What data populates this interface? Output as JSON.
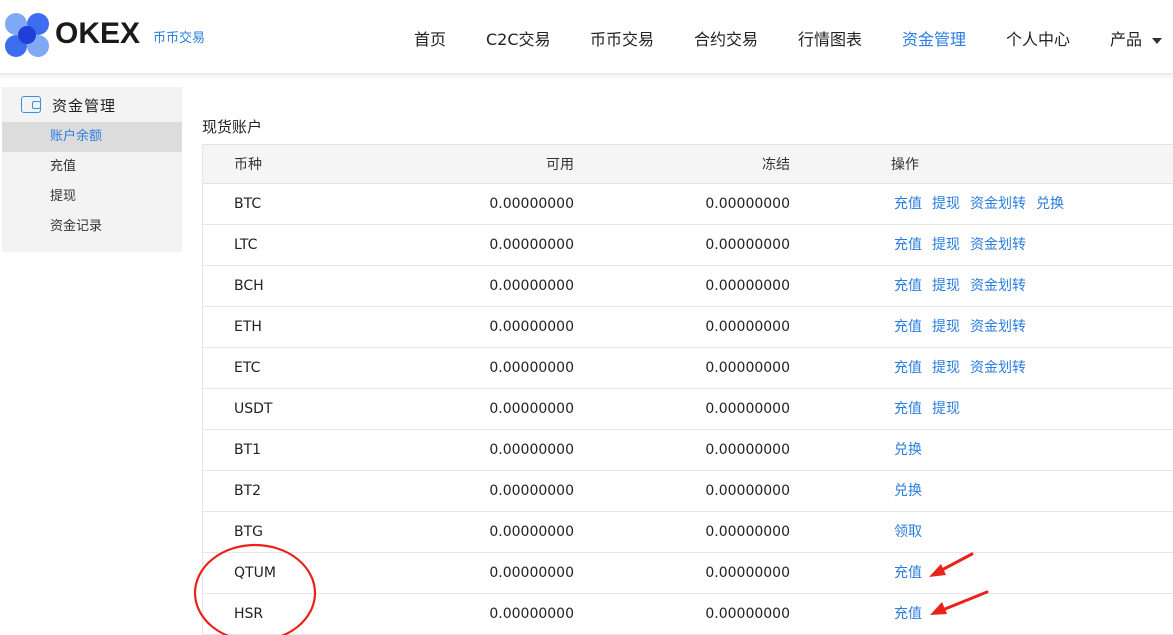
{
  "header": {
    "brand": "OKEX",
    "brand_sub": "币币交易",
    "nav": [
      {
        "label": "首页"
      },
      {
        "label": "C2C交易"
      },
      {
        "label": "币币交易"
      },
      {
        "label": "合约交易"
      },
      {
        "label": "行情图表"
      },
      {
        "label": "资金管理",
        "active": true
      },
      {
        "label": "个人中心"
      },
      {
        "label": "产品",
        "dropdown": true
      }
    ]
  },
  "sidebar": {
    "title": "资金管理",
    "icon": "wallet-icon",
    "items": [
      {
        "label": "账户余额",
        "active": true
      },
      {
        "label": "充值"
      },
      {
        "label": "提现"
      },
      {
        "label": "资金记录"
      }
    ]
  },
  "main": {
    "title": "现货账户",
    "columns": [
      "币种",
      "可用",
      "冻结",
      "操作"
    ],
    "rows": [
      {
        "coin": "BTC",
        "available": "0.00000000",
        "frozen": "0.00000000",
        "ops": [
          "充值",
          "提现",
          "资金划转",
          "兑换"
        ]
      },
      {
        "coin": "LTC",
        "available": "0.00000000",
        "frozen": "0.00000000",
        "ops": [
          "充值",
          "提现",
          "资金划转"
        ]
      },
      {
        "coin": "BCH",
        "available": "0.00000000",
        "frozen": "0.00000000",
        "ops": [
          "充值",
          "提现",
          "资金划转"
        ]
      },
      {
        "coin": "ETH",
        "available": "0.00000000",
        "frozen": "0.00000000",
        "ops": [
          "充值",
          "提现",
          "资金划转"
        ]
      },
      {
        "coin": "ETC",
        "available": "0.00000000",
        "frozen": "0.00000000",
        "ops": [
          "充值",
          "提现",
          "资金划转"
        ]
      },
      {
        "coin": "USDT",
        "available": "0.00000000",
        "frozen": "0.00000000",
        "ops": [
          "充值",
          "提现"
        ]
      },
      {
        "coin": "BT1",
        "available": "0.00000000",
        "frozen": "0.00000000",
        "ops": [
          "兑换"
        ]
      },
      {
        "coin": "BT2",
        "available": "0.00000000",
        "frozen": "0.00000000",
        "ops": [
          "兑换"
        ]
      },
      {
        "coin": "BTG",
        "available": "0.00000000",
        "frozen": "0.00000000",
        "ops": [
          "领取"
        ]
      },
      {
        "coin": "QTUM",
        "available": "0.00000000",
        "frozen": "0.00000000",
        "ops": [
          "充值"
        ]
      },
      {
        "coin": "HSR",
        "available": "0.00000000",
        "frozen": "0.00000000",
        "ops": [
          "充值"
        ]
      }
    ]
  },
  "colors": {
    "accent": "#2a7de1",
    "annotation": "#e8231b"
  }
}
